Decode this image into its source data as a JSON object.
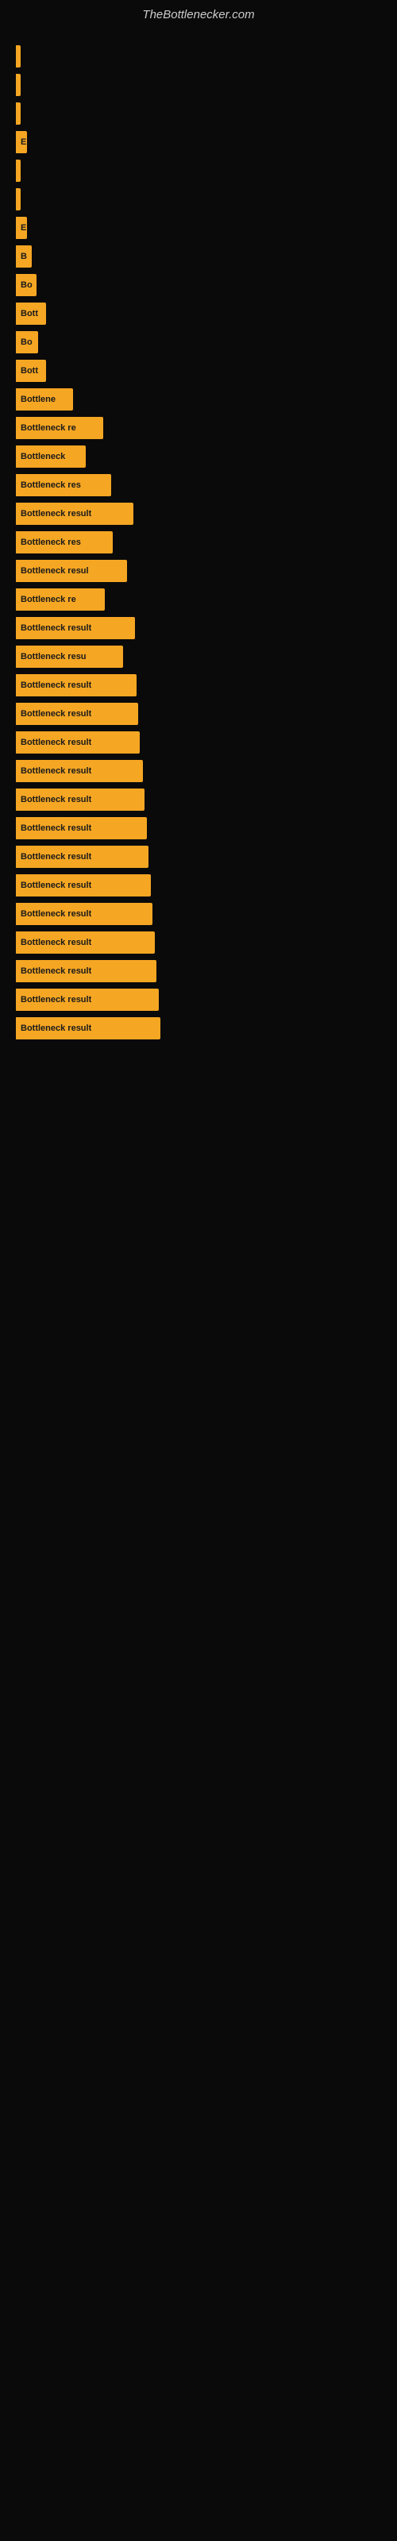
{
  "header": {
    "title": "TheBottlenecker.com"
  },
  "bars": [
    {
      "label": "|",
      "width": 4
    },
    {
      "label": "|",
      "width": 4
    },
    {
      "label": "|",
      "width": 4
    },
    {
      "label": "E",
      "width": 14
    },
    {
      "label": "|",
      "width": 4
    },
    {
      "label": "|",
      "width": 4
    },
    {
      "label": "E",
      "width": 14
    },
    {
      "label": "B",
      "width": 20
    },
    {
      "label": "Bo",
      "width": 26
    },
    {
      "label": "Bott",
      "width": 38
    },
    {
      "label": "Bo",
      "width": 28
    },
    {
      "label": "Bott",
      "width": 38
    },
    {
      "label": "Bottlene",
      "width": 72
    },
    {
      "label": "Bottleneck re",
      "width": 110
    },
    {
      "label": "Bottleneck",
      "width": 88
    },
    {
      "label": "Bottleneck res",
      "width": 120
    },
    {
      "label": "Bottleneck result",
      "width": 148
    },
    {
      "label": "Bottleneck res",
      "width": 122
    },
    {
      "label": "Bottleneck resul",
      "width": 140
    },
    {
      "label": "Bottleneck re",
      "width": 112
    },
    {
      "label": "Bottleneck result",
      "width": 150
    },
    {
      "label": "Bottleneck resu",
      "width": 135
    },
    {
      "label": "Bottleneck result",
      "width": 152
    },
    {
      "label": "Bottleneck result",
      "width": 154
    },
    {
      "label": "Bottleneck result",
      "width": 156
    },
    {
      "label": "Bottleneck result",
      "width": 160
    },
    {
      "label": "Bottleneck result",
      "width": 162
    },
    {
      "label": "Bottleneck result",
      "width": 165
    },
    {
      "label": "Bottleneck result",
      "width": 167
    },
    {
      "label": "Bottleneck result",
      "width": 170
    },
    {
      "label": "Bottleneck result",
      "width": 172
    },
    {
      "label": "Bottleneck result",
      "width": 175
    },
    {
      "label": "Bottleneck result",
      "width": 177
    },
    {
      "label": "Bottleneck result",
      "width": 180
    },
    {
      "label": "Bottleneck result",
      "width": 182
    }
  ]
}
